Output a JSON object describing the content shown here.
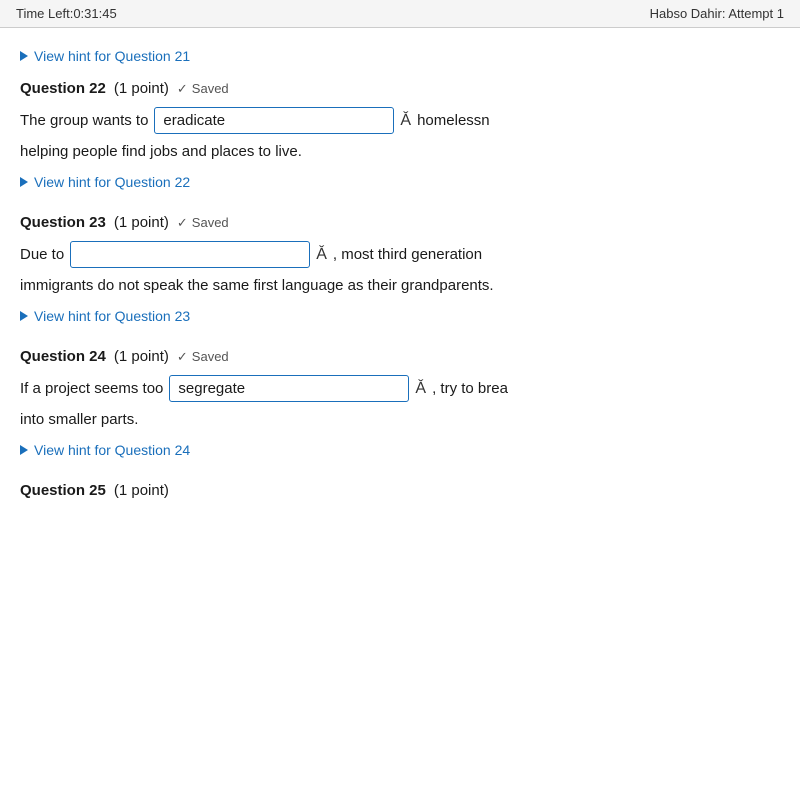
{
  "topbar": {
    "time_left_label": "Time Left:0:31:45",
    "attempt_label": "Habso Dahir: Attempt 1"
  },
  "hint21": {
    "label": "View hint for Question 21"
  },
  "question22": {
    "label": "Question 22",
    "points": "(1 point)",
    "saved": "Saved",
    "prefix": "The group wants to",
    "input_value": "eradicate",
    "input_placeholder": "",
    "suffix": "homelessn",
    "continuation": "helping people find jobs and places to live.",
    "hint_label": "View hint for Question 22"
  },
  "question23": {
    "label": "Question 23",
    "points": "(1 point)",
    "saved": "Saved",
    "prefix": "Due to",
    "input_value": "",
    "input_placeholder": "",
    "suffix": ", most third generation",
    "continuation": "immigrants do not speak the same first language as their grandparents.",
    "hint_label": "View hint for Question 23"
  },
  "question24": {
    "label": "Question 24",
    "points": "(1 point)",
    "saved": "Saved",
    "prefix": "If a project seems too",
    "input_value": "segregate",
    "input_placeholder": "",
    "suffix": ", try to brea",
    "continuation": "into smaller parts.",
    "hint_label": "View hint for Question 24"
  },
  "question25": {
    "label": "Question 25",
    "points": "(1 point)"
  },
  "icons": {
    "spell_check": "Ă"
  }
}
